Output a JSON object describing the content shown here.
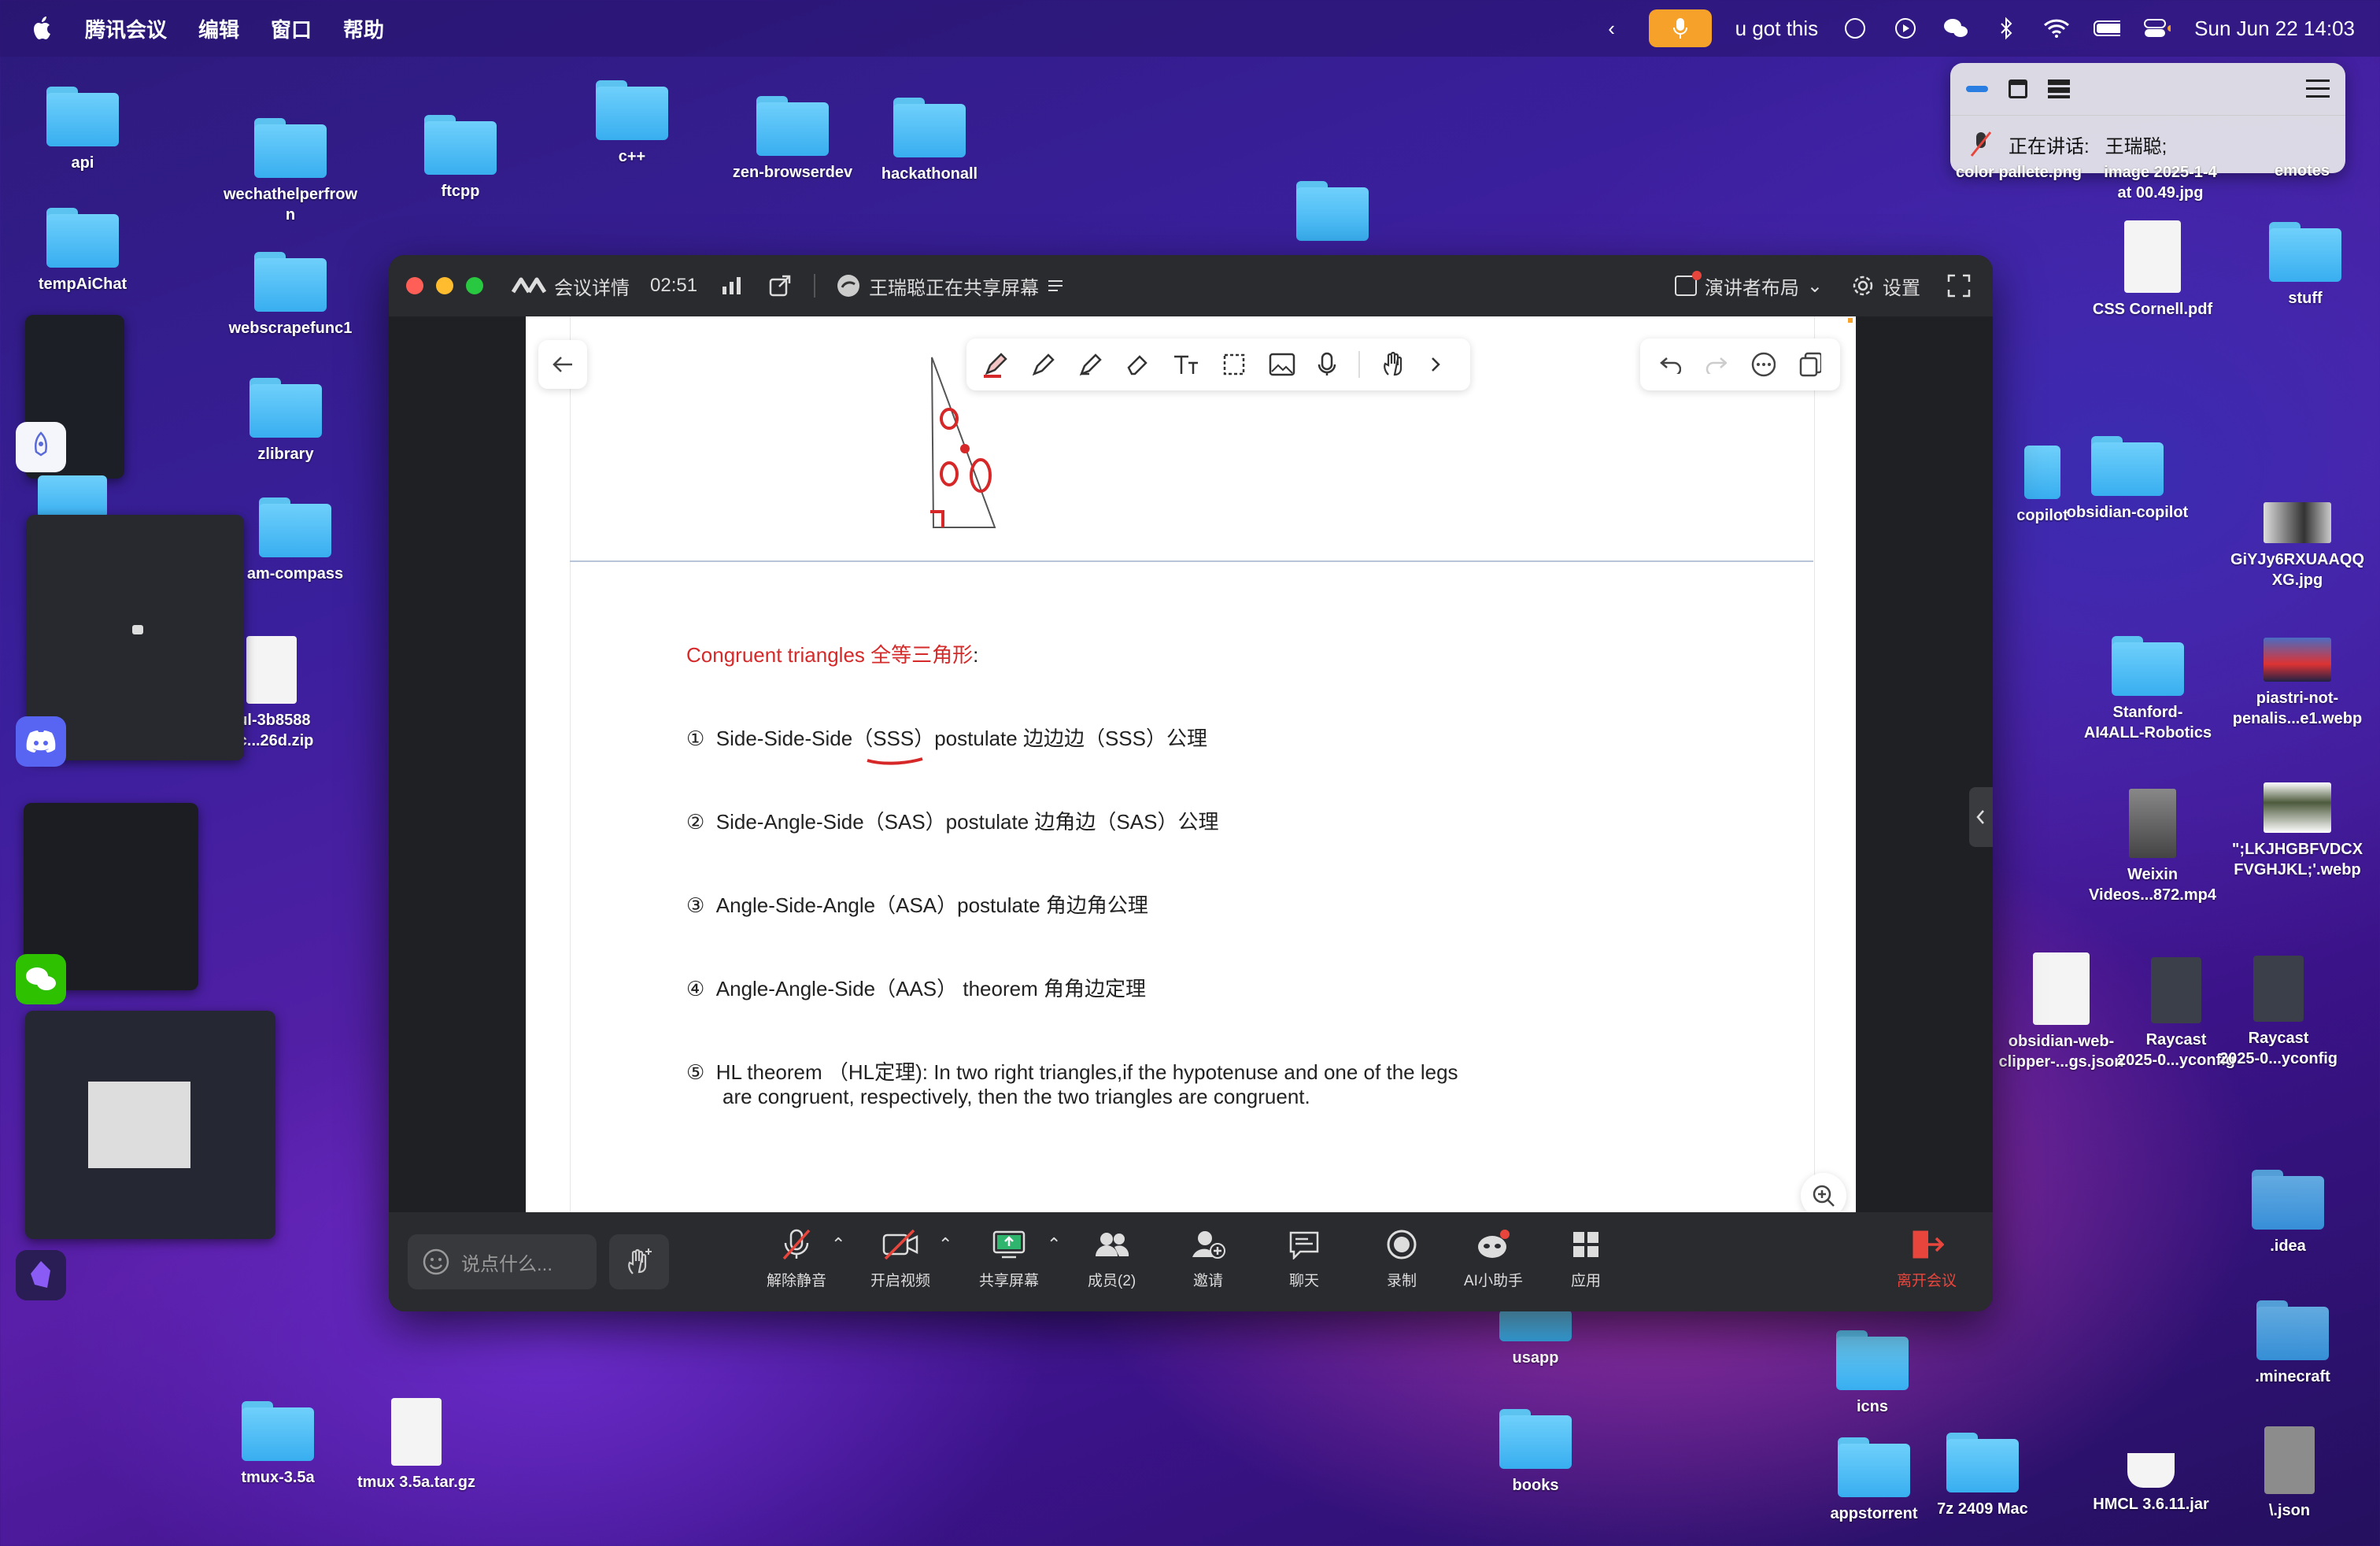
{
  "menubar": {
    "app": "腾讯会议",
    "menus": [
      "编辑",
      "窗口",
      "帮助"
    ],
    "caption": "u got this",
    "datetime": "Sun Jun 22  14:03"
  },
  "popup": {
    "speaking_label": "正在讲话:",
    "speaker": "王瑞聪;"
  },
  "desktop": {
    "items": [
      {
        "label": "api"
      },
      {
        "label": "wechathelperfrown"
      },
      {
        "label": "ftcpp"
      },
      {
        "label": "c++"
      },
      {
        "label": "zen-browserdev"
      },
      {
        "label": "hackathonall"
      },
      {
        "label": "tempAiChat"
      },
      {
        "label": "webscrapefunc1"
      },
      {
        "label": "zlibrary"
      },
      {
        "label": "am-compass"
      },
      {
        "label": "ful-3b8588\n5c...26d.zip"
      },
      {
        "label": "color pallete.png"
      },
      {
        "label": "image 2025-1-4\nat 00.49.jpg"
      },
      {
        "label": "emotes"
      },
      {
        "label": "CSS Cornell.pdf"
      },
      {
        "label": "stuff"
      },
      {
        "label": "copilot"
      },
      {
        "label": "obsidian-copilot"
      },
      {
        "label": "GiYJy6RXUAAQQ\nXG.jpg"
      },
      {
        "label": "Stanford-\nAI4ALL-Robotics"
      },
      {
        "label": "piastri-not-\npenalis...e1.webp"
      },
      {
        "label": "Weixin\nVideos...872.mp4"
      },
      {
        "label": "\";LKJHGBFVDCX\nFVGHJKL;'.webp"
      },
      {
        "label": "obsidian-web-\nclipper-...gs.json"
      },
      {
        "label": "Raycast\n2025-0...yconfig"
      },
      {
        "label": "Raycast\n2025-0...yconfig"
      },
      {
        "label": ".idea"
      },
      {
        "label": ".minecraft"
      },
      {
        "label": "usapp"
      },
      {
        "label": "icns"
      },
      {
        "label": "books"
      },
      {
        "label": "tmux-3.5a"
      },
      {
        "label": "tmux 3.5a.tar.gz"
      },
      {
        "label": "appstorrent"
      },
      {
        "label": "7z 2409 Mac"
      },
      {
        "label": "HMCL 3.6.11.jar"
      },
      {
        "label": "\\.json"
      }
    ]
  },
  "meeting": {
    "details_label": "会议详情",
    "timer": "02:51",
    "sharing_status": "王瑞聪正在共享屏幕",
    "layout_label": "演讲者布局",
    "settings_label": "设置",
    "chat_placeholder": "说点什么...",
    "controls": {
      "mute": "解除静音",
      "video": "开启视频",
      "share": "共享屏幕",
      "members": "成员(2)",
      "invite": "邀请",
      "chat": "聊天",
      "record": "录制",
      "ai": "AI小助手",
      "apps": "应用",
      "leave": "离开会议"
    }
  },
  "slide": {
    "heading_en": "Congruent triangles ",
    "heading_zh": "全等三角形",
    "heading_colon": ":",
    "items": [
      {
        "num": "①",
        "text": "Side-Side-Side（SSS）postulate 边边边（SSS）公理"
      },
      {
        "num": "②",
        "text": "Side-Angle-Side（SAS）postulate 边角边（SAS）公理"
      },
      {
        "num": "③",
        "text": "Angle-Side-Angle（ASA）postulate 角边角公理"
      },
      {
        "num": "④",
        "text": "Angle-Angle-Side（AAS） theorem 角角边定理"
      },
      {
        "num": "⑤",
        "text": "HL theorem （HL定理): In two right triangles,if the hypotenuse and one of the legs"
      }
    ],
    "item5_line2": "are congruent, respectively, then the two triangles are congruent."
  },
  "colors": {
    "accent_orange": "#f5a12a",
    "leave_red": "#e8453c",
    "heading_red": "#d42a2a",
    "folder_blue": "#4fbef4"
  }
}
